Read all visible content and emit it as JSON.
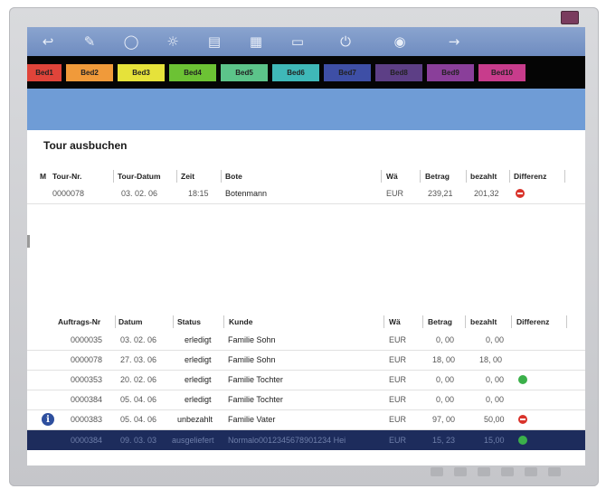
{
  "toolbar": {
    "icons": [
      "back-icon",
      "gift-icon",
      "lock-icon",
      "basket-icon",
      "printer-icon",
      "building-icon",
      "document-icon",
      "power-icon",
      "help-icon",
      "exit-icon"
    ]
  },
  "tabs": [
    {
      "label": "Bed1",
      "color": "#e0443a"
    },
    {
      "label": "Bed2",
      "color": "#f09a3a"
    },
    {
      "label": "Bed3",
      "color": "#e6e23a"
    },
    {
      "label": "Bed4",
      "color": "#6cc234"
    },
    {
      "label": "Bed5",
      "color": "#5cc48a"
    },
    {
      "label": "Bed6",
      "color": "#3fb8b8"
    },
    {
      "label": "Bed7",
      "color": "#3e4fa6"
    },
    {
      "label": "Bed8",
      "color": "#5d3f86"
    },
    {
      "label": "Bed9",
      "color": "#8a3f9a"
    },
    {
      "label": "Bed10",
      "color": "#c83c8c"
    }
  ],
  "page": {
    "title": "Tour ausbuchen"
  },
  "tour_table": {
    "headers": {
      "m": "M",
      "nr": "Tour-Nr.",
      "datum": "Tour-Datum",
      "zeit": "Zeit",
      "bote": "Bote",
      "wae": "Wä",
      "betrag": "Betrag",
      "bezahlt": "bezahlt",
      "differenz": "Differenz"
    },
    "rows": [
      {
        "nr": "0000078",
        "datum": "03. 02. 06",
        "zeit": "18:15",
        "bote": "Botenmann",
        "wae": "EUR",
        "betrag": "239,21",
        "bezahlt": "201,32",
        "status_dot": "red"
      }
    ]
  },
  "order_table": {
    "headers": {
      "nr": "Auftrags-Nr",
      "datum": "Datum",
      "status": "Status",
      "kunde": "Kunde",
      "wae": "Wä",
      "betrag": "Betrag",
      "bezahlt": "bezahlt",
      "differenz": "Differenz"
    },
    "rows": [
      {
        "nr": "0000035",
        "datum": "03. 02. 06",
        "status": "erledigt",
        "kunde": "Familie Sohn",
        "wae": "EUR",
        "betrag": "0, 00",
        "bezahlt": "0, 00",
        "status_dot": ""
      },
      {
        "nr": "0000078",
        "datum": "27. 03. 06",
        "status": "erledigt",
        "kunde": "Familie Sohn",
        "wae": "EUR",
        "betrag": "18, 00",
        "bezahlt": "18, 00",
        "status_dot": ""
      },
      {
        "nr": "0000353",
        "datum": "20. 02. 06",
        "status": "erledigt",
        "kunde": "Familie Tochter",
        "wae": "EUR",
        "betrag": "0, 00",
        "bezahlt": "0, 00",
        "status_dot": "green"
      },
      {
        "nr": "0000384",
        "datum": "05. 04. 06",
        "status": "erledigt",
        "kunde": "Familie Tochter",
        "wae": "EUR",
        "betrag": "0, 00",
        "bezahlt": "0, 00",
        "status_dot": ""
      },
      {
        "nr": "0000383",
        "datum": "05. 04. 06",
        "status": "unbezahlt",
        "kunde": "Familie Vater",
        "wae": "EUR",
        "betrag": "97, 00",
        "bezahlt": "50,00",
        "status_dot": "red",
        "info": true
      },
      {
        "nr": "0000384",
        "datum": "09. 03. 03",
        "status": "ausgeliefert",
        "kunde": "Normalo0012345678901234 Hei",
        "wae": "EUR",
        "betrag": "15, 23",
        "bezahlt": "15,00",
        "status_dot": "green",
        "selected": true
      }
    ]
  },
  "bottom_controls": [
    "bottom-control-1",
    "bottom-control-2",
    "bottom-control-3",
    "bottom-control-4",
    "bottom-control-5",
    "bottom-control-6"
  ]
}
